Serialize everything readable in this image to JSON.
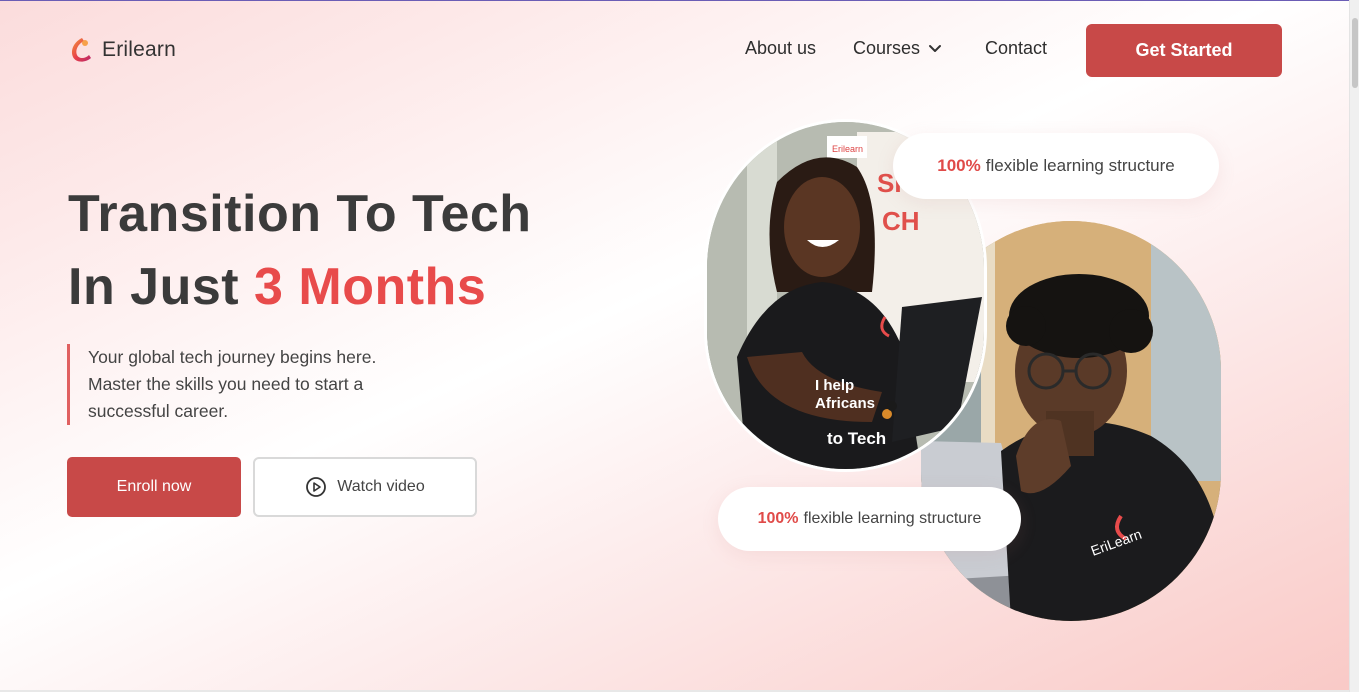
{
  "brand": {
    "name": "Erilearn",
    "logo_icon": "erilearn-logo-icon",
    "accent_color": "#c84948",
    "highlight_color": "#e84b4b"
  },
  "nav": {
    "items": [
      {
        "label": "About us"
      },
      {
        "label": "Courses",
        "has_dropdown": true,
        "icon": "chevron-down-icon"
      },
      {
        "label": "Contact"
      }
    ],
    "cta": "Get Started"
  },
  "hero": {
    "title_line1": "Transition To Tech",
    "title_line2_prefix": "In Just ",
    "title_line2_accent": "3 Months",
    "subtitle_line1": "Your global tech journey begins here.",
    "subtitle_line2": "Master the skills you need to start a",
    "subtitle_line3": "successful career.",
    "enroll_label": "Enroll now",
    "watch_label": "Watch video",
    "watch_icon": "play-circle-icon"
  },
  "badges": [
    {
      "percent": "100%",
      "text": "flexible learning structure"
    },
    {
      "percent": "100%",
      "text": "flexible learning structure"
    }
  ]
}
